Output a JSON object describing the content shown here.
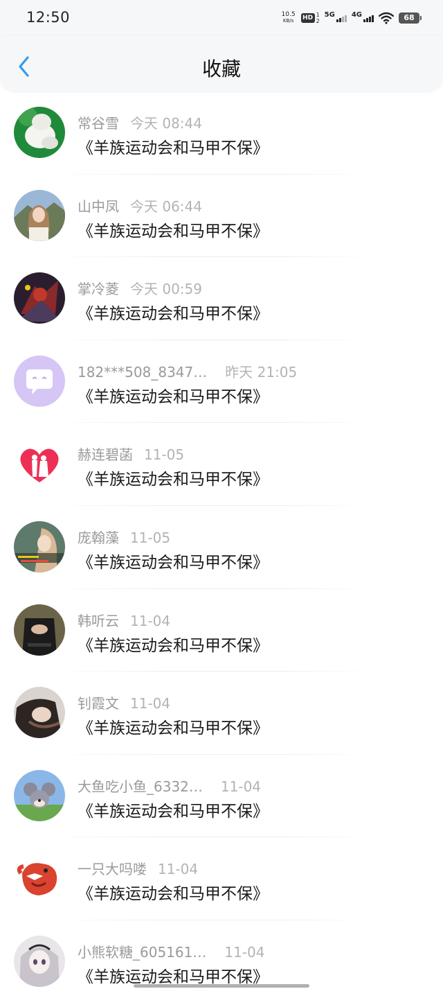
{
  "status_bar": {
    "time": "12:50",
    "speed_value": "10.5",
    "speed_unit": "KB/s",
    "hd_label": "HD",
    "sim1": "1",
    "sim2": "2",
    "net1_label": "5G",
    "net2_label": "4G",
    "battery": "68"
  },
  "header": {
    "title": "收藏",
    "back_icon": "chevron-left-icon",
    "accent_color": "#2f9bef"
  },
  "items": [
    {
      "name": "常谷雪",
      "time": "今天 08:44",
      "title": "《羊族运动会和马甲不保》",
      "avatar": "white-toy-avatar"
    },
    {
      "name": "山中凤",
      "time": "今天 06:44",
      "title": "《羊族运动会和马甲不保》",
      "avatar": "girl-mountain-avatar"
    },
    {
      "name": "掌冷菱",
      "time": "今天 00:59",
      "title": "《羊族运动会和马甲不保》",
      "avatar": "game-hero-avatar"
    },
    {
      "name": "182***508_8347…",
      "time": "昨天 21:05",
      "title": "《羊族运动会和马甲不保》",
      "avatar": "default-chat-avatar"
    },
    {
      "name": "赫连碧菡",
      "time": "11-05",
      "title": "《羊族运动会和马甲不保》",
      "avatar": "heart-couple-avatar"
    },
    {
      "name": "庞翰藻",
      "time": "11-05",
      "title": "《羊族运动会和马甲不保》",
      "avatar": "girl-meme-avatar"
    },
    {
      "name": "韩听云",
      "time": "11-04",
      "title": "《羊族运动会和马甲不保》",
      "avatar": "dark-outfit-avatar"
    },
    {
      "name": "钊霞文",
      "time": "11-04",
      "title": "《羊族运动会和马甲不保》",
      "avatar": "bw-portrait-avatar"
    },
    {
      "name": "大鱼吃小鱼_6332…",
      "time": "11-04",
      "title": "《羊族运动会和马甲不保》",
      "avatar": "cartoon-mouse-avatar"
    },
    {
      "name": "一只大吗喽",
      "time": "11-04",
      "title": "《羊族运动会和马甲不保》",
      "avatar": "red-cartoon-avatar"
    },
    {
      "name": "小熊软糖_605161…",
      "time": "11-04",
      "title": "《羊族运动会和马甲不保》",
      "avatar": "anime-girl-avatar"
    }
  ]
}
